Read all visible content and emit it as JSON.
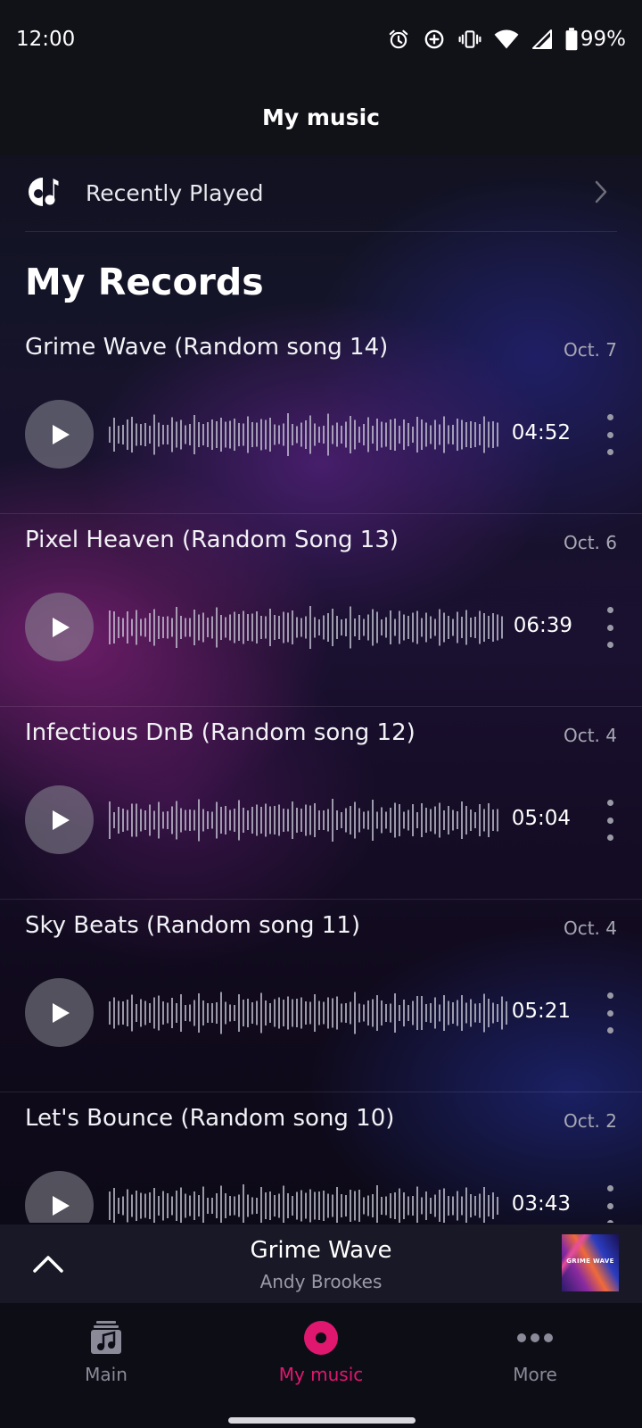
{
  "status_bar": {
    "time": "12:00",
    "battery": "99%",
    "icons": [
      "alarm-icon",
      "data-saver-icon",
      "vibrate-icon",
      "wifi-icon",
      "signal-icon",
      "battery-icon"
    ]
  },
  "header": {
    "title": "My music"
  },
  "recent": {
    "label": "Recently Played",
    "icon": "music-note-icon"
  },
  "section_title": "My Records",
  "records": [
    {
      "title": "Grime Wave (Random song 14)",
      "date": "Oct. 7",
      "duration": "04:52"
    },
    {
      "title": "Pixel Heaven (Random Song 13)",
      "date": "Oct. 6",
      "duration": "06:39"
    },
    {
      "title": "Infectious DnB (Random song 12)",
      "date": "Oct. 4",
      "duration": "05:04"
    },
    {
      "title": "Sky Beats (Random song 11)",
      "date": "Oct. 4",
      "duration": "05:21"
    },
    {
      "title": "Let's Bounce (Random song 10)",
      "date": "Oct. 2",
      "duration": "03:43"
    }
  ],
  "mini_player": {
    "title": "Grime Wave",
    "artist": "Andy Brookes",
    "art_text": "GRIME WAVE"
  },
  "nav": {
    "items": [
      {
        "label": "Main",
        "icon": "music-library-icon"
      },
      {
        "label": "My music",
        "icon": "record-icon"
      },
      {
        "label": "More",
        "icon": "more-horizontal-icon"
      }
    ],
    "active_index": 1
  },
  "colors": {
    "accent": "#e0176f",
    "inactive": "#8a8a98",
    "background": "#0c0c12"
  }
}
